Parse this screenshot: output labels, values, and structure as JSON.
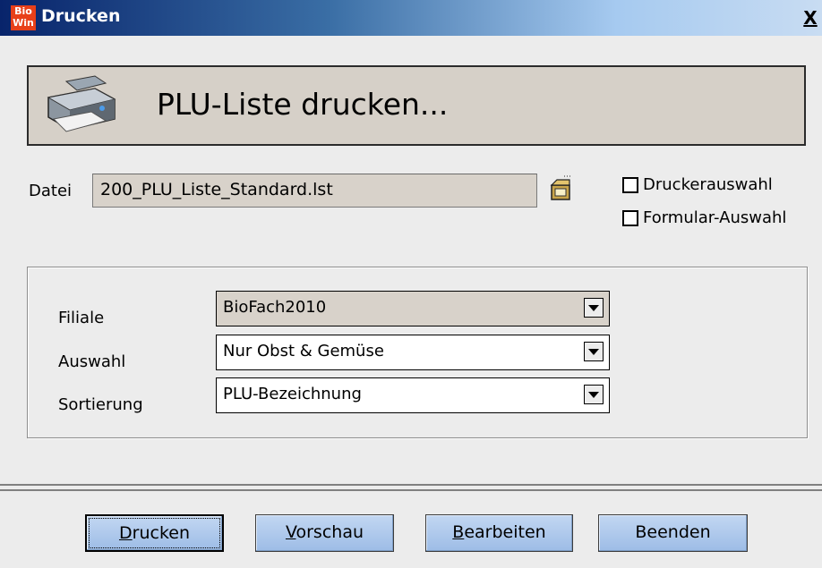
{
  "window": {
    "icon_text_top": "Bio",
    "icon_text_bottom": "Win",
    "title": "Drucken",
    "close_label": "X"
  },
  "banner": {
    "icon": "printer-icon",
    "title": "PLU-Liste drucken..."
  },
  "file": {
    "label": "Datei",
    "value": "200_PLU_Liste_Standard.lst",
    "browse_icon": "folder-open-icon"
  },
  "options": {
    "printer_select": {
      "label": "Druckerauswahl",
      "checked": false
    },
    "form_select": {
      "label": "Formular-Auswahl",
      "checked": false
    }
  },
  "fields": {
    "filiale": {
      "label": "Filiale",
      "value": "BioFach2010",
      "enabled": false
    },
    "auswahl": {
      "label": "Auswahl",
      "value": "Nur Obst & Gemüse",
      "enabled": true
    },
    "sortierung": {
      "label": "Sortierung",
      "value": "PLU-Bezeichnung",
      "enabled": true
    }
  },
  "buttons": {
    "print": {
      "accel": "D",
      "rest": "rucken"
    },
    "preview": {
      "accel": "V",
      "rest": "orschau"
    },
    "edit": {
      "accel": "B",
      "rest": "earbeiten"
    },
    "exit": {
      "label": "Beenden"
    }
  }
}
